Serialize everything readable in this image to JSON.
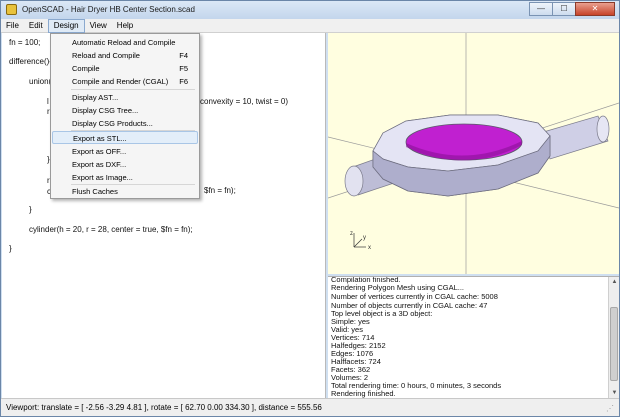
{
  "window": {
    "title": "OpenSCAD - Hair Dryer HB Center Section.scad",
    "minimize_glyph": "—",
    "maximize_glyph": "☐",
    "close_glyph": "✕"
  },
  "menubar": [
    "File",
    "Edit",
    "Design",
    "View",
    "Help"
  ],
  "editor": {
    "lines": [
      "fn = 100;",
      "difference(){",
      "union(",
      "l",
      "r",
      "convexity = 10, twist = 0)",
      "}",
      "r",
      "c",
      "$fn = fn);",
      "}",
      "cylinder(h = 20, r = 28, center = true, $fn = fn);",
      "}"
    ]
  },
  "design_menu": {
    "items": [
      {
        "label": "Automatic Reload and Compile",
        "shortcut": ""
      },
      {
        "label": "Reload and Compile",
        "shortcut": "F4"
      },
      {
        "label": "Compile",
        "shortcut": "F5"
      },
      {
        "label": "Compile and Render (CGAL)",
        "shortcut": "F6"
      },
      {
        "label": "Display AST...",
        "shortcut": ""
      },
      {
        "label": "Display CSG Tree...",
        "shortcut": ""
      },
      {
        "label": "Display CSG Products...",
        "shortcut": ""
      },
      {
        "label": "Export as STL...",
        "shortcut": ""
      },
      {
        "label": "Export as OFF...",
        "shortcut": ""
      },
      {
        "label": "Export as DXF...",
        "shortcut": ""
      },
      {
        "label": "Export as Image...",
        "shortcut": ""
      },
      {
        "label": "Flush Caches",
        "shortcut": ""
      }
    ],
    "highlighted": "Export as STL..."
  },
  "viewport": {
    "axis_labels": {
      "x": "x",
      "y": "y",
      "z": "z"
    },
    "colors": {
      "background": "#fffee0",
      "body": "#dcdcf0",
      "inner": "#c020d0"
    }
  },
  "console": {
    "lines": [
      "Compilation finished.",
      "Rendering Polygon Mesh using CGAL...",
      "Number of vertices currently in CGAL cache: 5008",
      "Number of objects currently in CGAL cache: 47",
      "   Top level object is a 3D object:",
      "   Simple:        yes",
      "   Valid:         yes",
      "   Vertices:      714",
      "   Halfedges:     2152",
      "   Edges:         1076",
      "   Halffacets:    724",
      "   Facets:        362",
      "   Volumes:       2",
      "Total rendering time: 0 hours, 0 minutes, 3 seconds",
      "Rendering finished."
    ]
  },
  "statusbar": {
    "text": "Viewport: translate = [ -2.56 -3.29 4.81 ], rotate = [ 62.70 0.00 334.30 ], distance = 555.56"
  }
}
